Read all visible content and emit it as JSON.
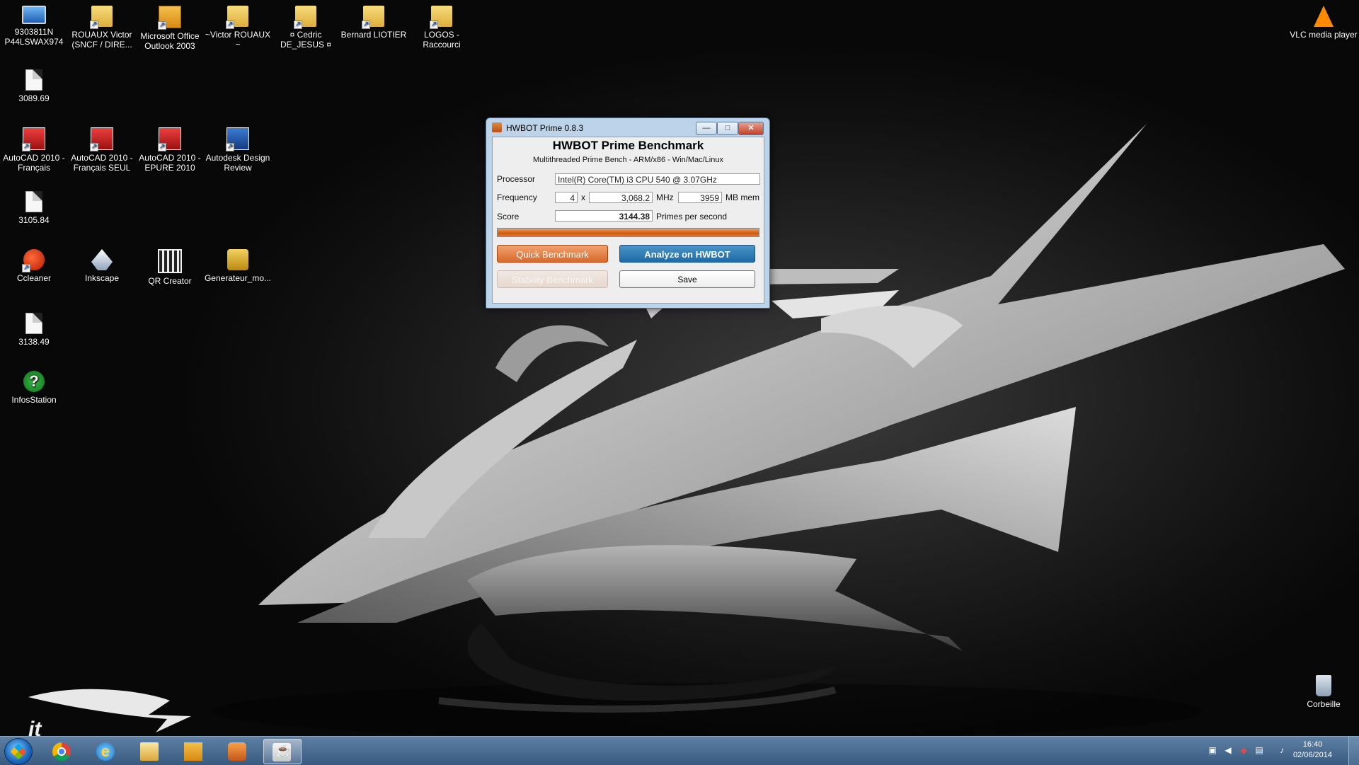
{
  "desktop": {
    "icons": [
      {
        "label": "9303811N P44LSWAX974",
        "icon": "computer-icon"
      },
      {
        "label": "ROUAUX Victor (SNCF / DIRE...",
        "icon": "folder-shortcut-icon"
      },
      {
        "label": "Microsoft Office Outlook 2003",
        "icon": "outlook-icon"
      },
      {
        "label": "~Victor ROUAUX ~",
        "icon": "folder-shortcut-icon"
      },
      {
        "label": "¤ Cedric DE_JESUS ¤",
        "icon": "folder-shortcut-icon"
      },
      {
        "label": "Bernard LIOTIER",
        "icon": "folder-shortcut-icon"
      },
      {
        "label": "LOGOS - Raccourci",
        "icon": "folder-shortcut-icon"
      },
      {
        "label": "3089.69",
        "icon": "document-icon"
      },
      {
        "label": "AutoCAD 2010 - Français",
        "icon": "autocad-icon"
      },
      {
        "label": "AutoCAD 2010 - Français SEUL",
        "icon": "autocad-icon"
      },
      {
        "label": "AutoCAD 2010 - EPURE 2010",
        "icon": "autocad-icon"
      },
      {
        "label": "Autodesk Design Review",
        "icon": "design-review-icon"
      },
      {
        "label": "3105.84",
        "icon": "document-icon"
      },
      {
        "label": "Ccleaner",
        "icon": "ccleaner-icon"
      },
      {
        "label": "Inkscape",
        "icon": "inkscape-icon"
      },
      {
        "label": "QR Creator",
        "icon": "qr-icon"
      },
      {
        "label": "Generateur_mo...",
        "icon": "lock-icon"
      },
      {
        "label": "3138.49",
        "icon": "document-icon"
      },
      {
        "label": "InfosStation",
        "icon": "help-icon"
      },
      {
        "label": "VLC media player",
        "icon": "vlc-icon"
      },
      {
        "label": "Corbeille",
        "icon": "recycle-bin-icon"
      }
    ]
  },
  "window": {
    "title": "HWBOT Prime 0.8.3",
    "controls": {
      "minimize": "—",
      "maximize": "□",
      "close": "✕"
    },
    "heading": "HWBOT Prime Benchmark",
    "subheading": "Multithreaded Prime Bench - ARM/x86 - Win/Mac/Linux",
    "processor_label": "Processor",
    "processor_value": "Intel(R) Core(TM) i3 CPU       540  @ 3.07GHz",
    "frequency_label": "Frequency",
    "multiplier": "4",
    "x_sep": "x",
    "base_clock": "3,068.2",
    "mhz_unit": "MHz",
    "memory": "3959",
    "mem_unit": "MB mem",
    "score_label": "Score",
    "score_value": "3144.38",
    "score_unit": "Primes per second",
    "progress": 1.0,
    "quick_benchmark": "Quick Benchmark",
    "analyze": "Analyze on HWBOT",
    "stability_benchmark": "Stability Benchmark",
    "save": "Save"
  },
  "taskbar": {
    "apps": [
      "chrome-icon",
      "internet-explorer-icon",
      "file-explorer-icon",
      "outlook-icon",
      "media-player-icon",
      "java-icon"
    ],
    "clock_time": "16:40",
    "clock_date": "02/06/2014"
  },
  "colors": {
    "accent_orange": "#d8692a",
    "accent_blue": "#1e6aa6",
    "taskbar": "#3a5b80"
  }
}
